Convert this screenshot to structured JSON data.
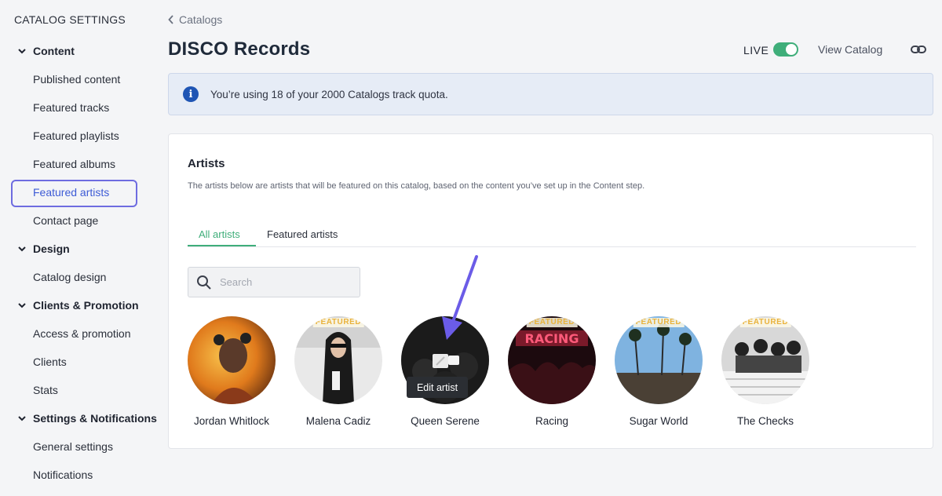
{
  "sidebar": {
    "title": "CATALOG SETTINGS",
    "sections": [
      {
        "label": "Content",
        "items": [
          "Published content",
          "Featured tracks",
          "Featured playlists",
          "Featured albums",
          "Featured artists",
          "Contact page"
        ]
      },
      {
        "label": "Design",
        "items": [
          "Catalog design"
        ]
      },
      {
        "label": "Clients & Promotion",
        "items": [
          "Access & promotion",
          "Clients",
          "Stats"
        ]
      },
      {
        "label": "Settings & Notifications",
        "items": [
          "General settings",
          "Notifications"
        ]
      }
    ],
    "active_item": "Featured artists"
  },
  "header": {
    "breadcrumb": "Catalogs",
    "title": "DISCO Records",
    "live_label": "LIVE",
    "live_on": true,
    "view_catalog": "View Catalog",
    "accent_color": "#3fae7a"
  },
  "banner": {
    "text": "You’re using 18 of your 2000 Catalogs track quota."
  },
  "artists_panel": {
    "title": "Artists",
    "description": "The artists below are artists that will be featured on this catalog, based on the content you’ve set up in the Content step.",
    "tabs": [
      "All artists",
      "Featured artists"
    ],
    "active_tab": "All artists",
    "search_placeholder": "Search",
    "badge_label": "FEATURED",
    "edit_tooltip": "Edit artist",
    "artists": [
      {
        "name": "Jordan Whitlock",
        "featured": false
      },
      {
        "name": "Malena Cadiz",
        "featured": true
      },
      {
        "name": "Queen Serene",
        "featured": false
      },
      {
        "name": "Racing",
        "featured": true
      },
      {
        "name": "Sugar World",
        "featured": true
      },
      {
        "name": "The Checks",
        "featured": true
      }
    ]
  }
}
